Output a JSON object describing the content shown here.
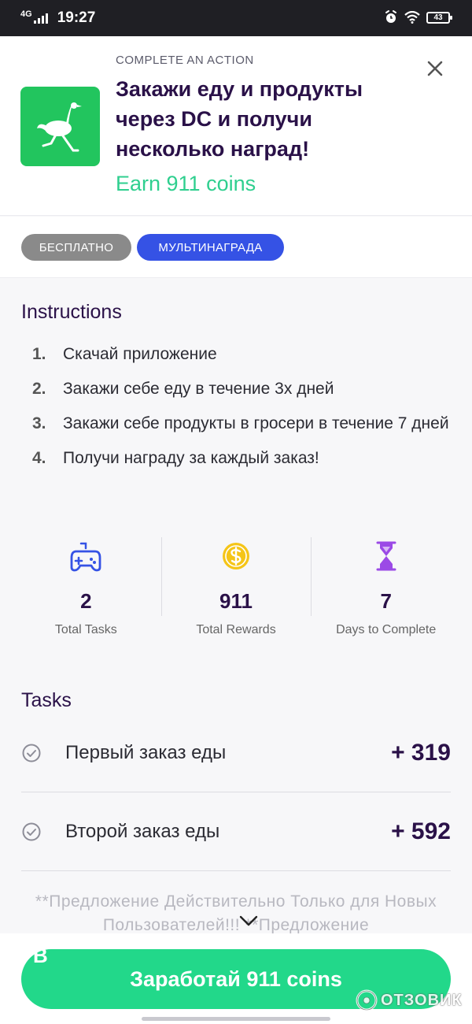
{
  "status_bar": {
    "network": "4G",
    "time": "19:27",
    "battery": "43",
    "icons": [
      "signal-icon",
      "alarm-icon",
      "wifi-icon",
      "battery-icon"
    ]
  },
  "offer": {
    "kicker": "COMPLETE AN ACTION",
    "title": "Закажи еду и продукты через DC и получи несколько наград!",
    "earn_text": "Earn 911 coins",
    "app_icon": "ostrich-icon",
    "tags": {
      "free": "БЕСПЛАТНО",
      "multi": "МУЛЬТИНАГРАДА"
    }
  },
  "instructions": {
    "title": "Instructions",
    "steps": [
      {
        "num": "1.",
        "text": "Скачай приложение"
      },
      {
        "num": "2.",
        "text": "Закажи себе еду в течение 3х дней"
      },
      {
        "num": "3.",
        "text": "Закажи себе продукты в гросери в течение 7 дней"
      },
      {
        "num": "4.",
        "text": "Получи награду за каждый заказ!"
      }
    ]
  },
  "stats": [
    {
      "value": "2",
      "label": "Total Tasks",
      "icon": "gamepad-icon"
    },
    {
      "value": "911",
      "label": "Total Rewards",
      "icon": "coin-icon"
    },
    {
      "value": "7",
      "label": "Days to Complete",
      "icon": "hourglass-icon"
    }
  ],
  "tasks": {
    "title": "Tasks",
    "items": [
      {
        "name": "Первый заказ еды",
        "reward": "+ 319"
      },
      {
        "name": "Второй заказ еды",
        "reward": "+ 592"
      }
    ]
  },
  "disclaimer": "**Предложение Действительно Только для Новых Пользователей!!! **Предложение",
  "stray_char": "В",
  "cta_label": "Заработай 911 coins",
  "watermark": "ОТЗОВИК",
  "colors": {
    "brand_purple": "#2a1148",
    "earn_green": "#2fcf8f",
    "cta_green": "#22d88a",
    "tag_blue": "#3552e5",
    "tag_gray": "#8a8a8a",
    "app_green": "#22c55e",
    "gamepad_blue": "#3552e5",
    "coin_yellow": "#f5c518",
    "hourglass_purple": "#9b4ae6"
  }
}
